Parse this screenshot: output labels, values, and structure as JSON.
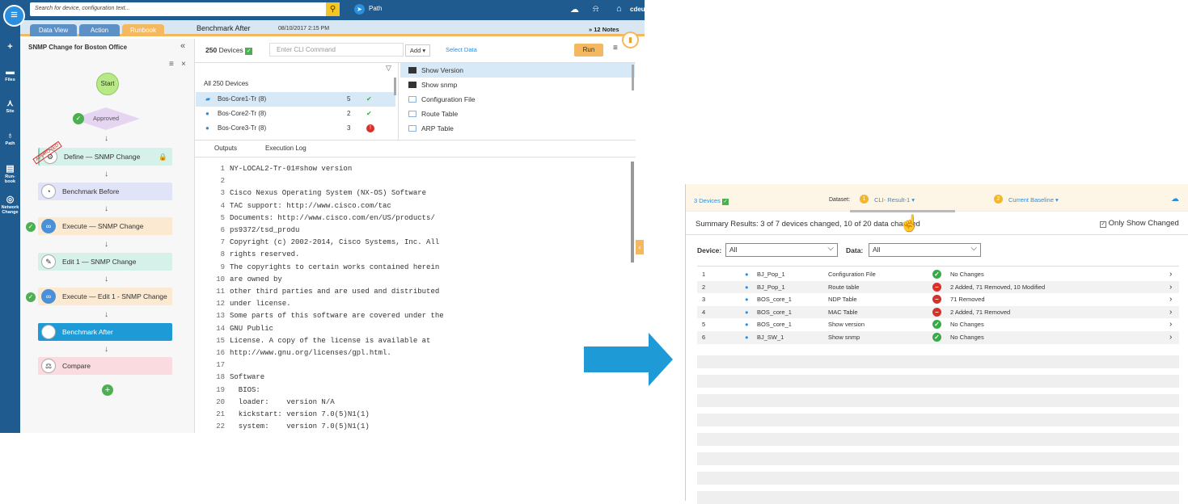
{
  "topbar": {
    "search_placeholder": "Search for device, configuration text...",
    "path_label": "Path",
    "user_label": "cdeu"
  },
  "tabs": [
    "Data View",
    "Action",
    "Runbook"
  ],
  "toolbar": {
    "title": "Benchmark After",
    "timestamp": "08/10/2017 2:15 PM",
    "notes": "12 Notes"
  },
  "runbook": {
    "title": "SNMP Change for Boston Office",
    "start": "Start",
    "approved": "Approved",
    "approved_stamp": "APPROVED",
    "nodes": [
      "Define — SNMP Change",
      "Benchmark Before",
      "Execute — SNMP Change",
      "Edit 1 — SNMP Change",
      "Execute — Edit 1 - SNMP Change",
      "Benchmark After",
      "Compare"
    ]
  },
  "devices": {
    "count": "250",
    "count_label": "Devices",
    "cli_placeholder": "Enter CLI Command",
    "add_label": "Add",
    "select_data": "Select Data",
    "run_label": "Run",
    "all_label": "All 250 Devices",
    "rows": [
      {
        "name": "Bos-Core1-Tr (8)",
        "count": "5",
        "status": "ok"
      },
      {
        "name": "Bos-Core2-Tr (8)",
        "count": "2",
        "status": "ok"
      },
      {
        "name": "Bos-Core3-Tr (8)",
        "count": "3",
        "status": "error"
      }
    ]
  },
  "commands": [
    "Show Version",
    "Show snmp",
    "Configuration File",
    "Route Table",
    "ARP Table"
  ],
  "output_tabs": [
    "Outputs",
    "Execution Log"
  ],
  "code_lines": [
    "NY-LOCAL2-Tr-01#show version",
    "",
    "Cisco Nexus Operating System (NX-OS) Software",
    "TAC support: http://www.cisco.com/tac",
    "Documents: http://www.cisco.com/en/US/products/",
    "ps9372/tsd_produ",
    "Copyright (c) 2002-2014, Cisco Systems, Inc. All",
    "rights reserved.",
    "The copyrights to certain works contained herein",
    "are owned by",
    "other third parties and are used and distributed",
    "under license.",
    "Some parts of this software are covered under the",
    "GNU Public",
    "License. A copy of the license is available at",
    "http://www.gnu.org/licenses/gpl.html.",
    "",
    "Software",
    "  BIOS:",
    "  loader:    version N/A",
    "  kickstart: version 7.0(5)N1(1)",
    "  system:    version 7.0(5)N1(1)"
  ],
  "compare": {
    "devices_label": "3 Devices",
    "dataset_label": "Dataset:",
    "dataset_1": "CLI- Result-1",
    "dataset_2": "Current Baseline",
    "summary": "Summary Results: 3 of 7 devices changed, 10 of 20 data changed",
    "only_changed": "Only Show Changed",
    "device_filter_label": "Device:",
    "device_filter_value": "All",
    "data_filter_label": "Data:",
    "data_filter_value": "All",
    "rows": [
      {
        "idx": "1",
        "device": "BJ_Pop_1",
        "data": "Configuration File",
        "status": "ok",
        "result": "No Changes"
      },
      {
        "idx": "2",
        "device": "BJ_Pop_1",
        "data": "Route table",
        "status": "changed",
        "result": "2 Added, 71 Removed, 10 Modified"
      },
      {
        "idx": "3",
        "device": "BOS_core_1",
        "data": "NDP Table",
        "status": "changed",
        "result": "71 Removed"
      },
      {
        "idx": "4",
        "device": "BOS_core_1",
        "data": "MAC Table",
        "status": "changed",
        "result": "2 Added, 71 Removed"
      },
      {
        "idx": "5",
        "device": "BOS_core_1",
        "data": "Show version",
        "status": "ok",
        "result": "No Changes"
      },
      {
        "idx": "6",
        "device": "BJ_SW_1",
        "data": "Show snmp",
        "status": "ok",
        "result": "No Changes"
      }
    ]
  },
  "rail": [
    "Files",
    "Site",
    "Path",
    "Run-book",
    "Network Change"
  ],
  "colors": {
    "nav": "#1f5b8e",
    "accent": "#f4b860",
    "ok": "#3aa94a",
    "error": "#d9302a",
    "arrow": "#1e9ad6"
  }
}
